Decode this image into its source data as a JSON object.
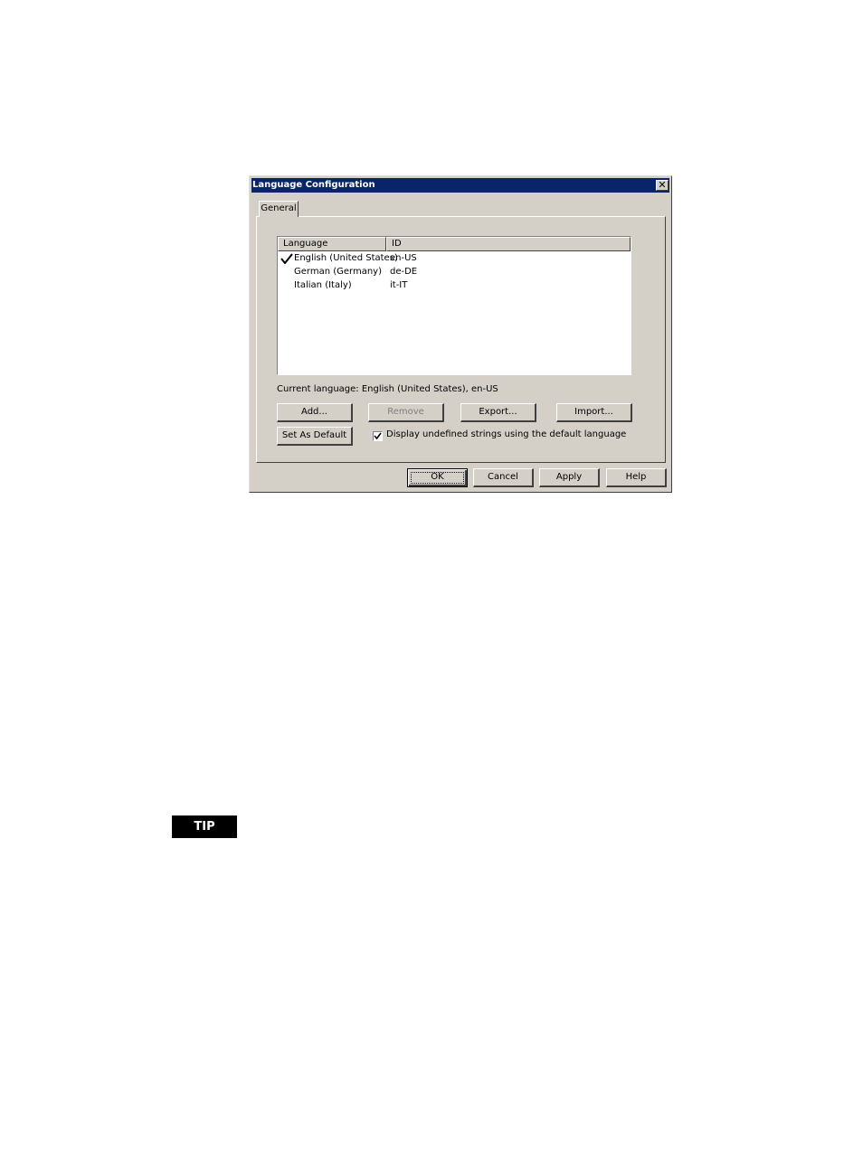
{
  "window": {
    "title": "Language Configuration",
    "close_glyph": "✕",
    "close_icon": "close-icon"
  },
  "tabs": [
    {
      "label": "General",
      "selected": true
    }
  ],
  "list": {
    "columns": [
      "Language",
      "ID"
    ],
    "rows": [
      {
        "language": "English (United States)",
        "id": "en-US",
        "default": true
      },
      {
        "language": "German (Germany)",
        "id": "de-DE",
        "default": false
      },
      {
        "language": "Italian (Italy)",
        "id": "it-IT",
        "default": false
      }
    ]
  },
  "status": {
    "current_language": "Current language: English (United States), en-US"
  },
  "buttons": {
    "add": "Add...",
    "remove": "Remove",
    "export": "Export...",
    "import": "Import...",
    "set_default": "Set As Default",
    "ok": "OK",
    "cancel": "Cancel",
    "apply": "Apply",
    "help": "Help"
  },
  "options": {
    "display_undefined_label": "Display undefined strings using the default language",
    "display_undefined_checked": true
  },
  "tip": {
    "label": "TIP"
  }
}
